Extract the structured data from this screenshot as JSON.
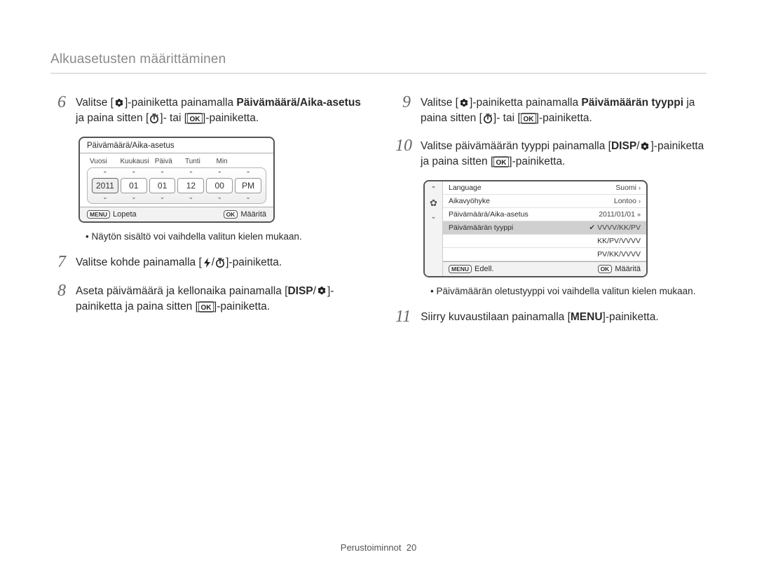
{
  "page_title": "Alkuasetusten määrittäminen",
  "footer": {
    "label": "Perustoiminnot",
    "page": "20"
  },
  "left": {
    "step6": {
      "num": "6",
      "t1": "Valitse [",
      "t2": "]-painiketta painamalla ",
      "bold1": "Päivämäärä/Aika-asetus",
      "t3": " ja paina sitten [",
      "t4": "]- tai [",
      "t5": "]-painiketta."
    },
    "screen1": {
      "title": "Päivämäärä/Aika-asetus",
      "labels": [
        "Vuosi",
        "Kuukausi",
        "Päivä",
        "Tunti",
        "Min",
        ""
      ],
      "values": [
        "2011",
        "01",
        "01",
        "12",
        "00",
        "PM"
      ],
      "ftr_left_pill": "MENU",
      "ftr_left": "Lopeta",
      "ftr_right_pill": "OK",
      "ftr_right": "Määritä"
    },
    "note1": "Näytön sisältö voi vaihdella valitun kielen mukaan.",
    "step7": {
      "num": "7",
      "t1": "Valitse kohde painamalla [",
      "t2": "/",
      "t3": "]-painiketta."
    },
    "step8": {
      "num": "8",
      "t1": "Aseta päivämäärä ja kellonaika painamalla [",
      "disp": "DISP",
      "t2": "/",
      "t3": "]-painiketta ja paina sitten [",
      "t4": "]-painiketta."
    }
  },
  "right": {
    "step9": {
      "num": "9",
      "t1": "Valitse [",
      "t2": "]-painiketta painamalla ",
      "bold1": "Päivämäärän tyyppi",
      "t3": " ja paina sitten [",
      "t4": "]- tai [",
      "t5": "]-painiketta."
    },
    "step10": {
      "num": "10",
      "t1": "Valitse päivämäärän tyyppi painamalla [",
      "disp": "DISP",
      "t2": "/",
      "t3": "]-painiketta ja paina sitten [",
      "t4": "]-painiketta."
    },
    "screen2": {
      "rows": [
        {
          "l": "Language",
          "r": "Suomi"
        },
        {
          "l": "Aikavyöhyke",
          "r": "Lontoo"
        },
        {
          "l": "Päivämäärä/Aika-asetus",
          "r": "2011/01/01"
        },
        {
          "l": "Päivämäärän tyyppi",
          "r": "VVVV/KK/PV",
          "sel": true
        }
      ],
      "subs": [
        "KK/PV/VVVV",
        "PV/KK/VVVV"
      ],
      "ftr_left_pill": "MENU",
      "ftr_left": "Edell.",
      "ftr_right_pill": "OK",
      "ftr_right": "Määritä"
    },
    "note2": "Päivämäärän oletustyyppi voi vaihdella valitun kielen mukaan.",
    "step11": {
      "num": "11",
      "t1": "Siirry kuvaustilaan painamalla [",
      "menu": "MENU",
      "t2": "]-painiketta."
    }
  }
}
